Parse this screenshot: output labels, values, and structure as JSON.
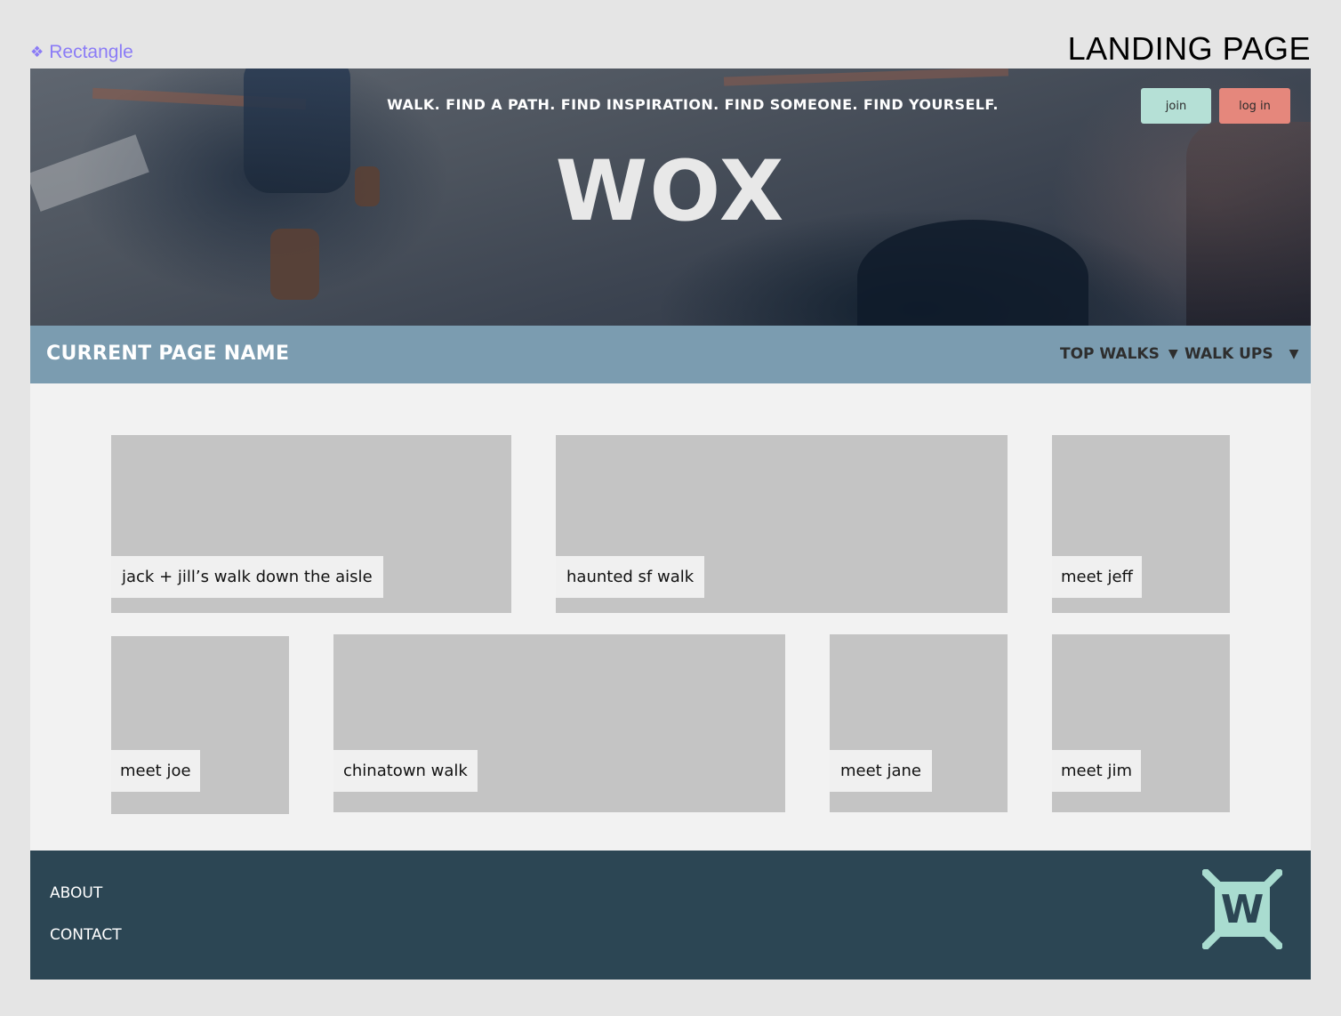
{
  "frame": {
    "label": "Rectangle",
    "page_title": "LANDING PAGE"
  },
  "hero": {
    "tagline": "WALK. FIND A PATH. FIND INSPIRATION. FIND SOMEONE. FIND YOURSELF.",
    "logo_text": "WOX",
    "join_label": "join",
    "login_label": "log in"
  },
  "nav": {
    "current_page": "CURRENT PAGE NAME",
    "dropdowns": [
      {
        "label": "TOP WALKS",
        "arrow": "▼"
      },
      {
        "label": "WALK UPS",
        "arrow": "▼"
      }
    ]
  },
  "tiles": [
    {
      "label": "jack + jill’s walk down the aisle"
    },
    {
      "label": "haunted sf walk"
    },
    {
      "label": "meet jeff"
    },
    {
      "label": "meet joe"
    },
    {
      "label": "chinatown walk"
    },
    {
      "label": "meet jane"
    },
    {
      "label": "meet jim"
    }
  ],
  "footer": {
    "about": "ABOUT",
    "contact": "CONTACT",
    "logo_letter": "W"
  },
  "colors": {
    "join_button": "#b5e0d6",
    "login_button": "#e5877c",
    "nav_bar": "#7b9cb0",
    "footer": "#2c4654",
    "tile_placeholder": "#c4c4c4",
    "logo_mint": "#a9dcd0",
    "frame_label": "#8b7cf6"
  }
}
